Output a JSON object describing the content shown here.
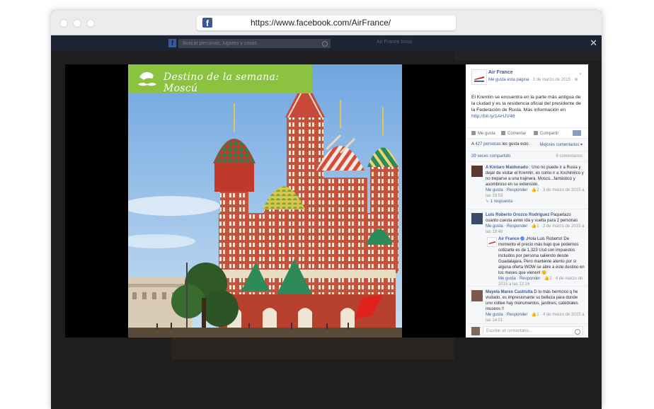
{
  "browser": {
    "url": "https://www.facebook.com/AirFrance/",
    "favicon": "facebook-f-icon"
  },
  "fb_header": {
    "search_placeholder": "Buscar personas, lugares y cosas",
    "right_text": "Air France  Inicio"
  },
  "photo": {
    "banner_text": "Destino de la semana: Moscú",
    "banner_color": "#8bc23f"
  },
  "post": {
    "page_name": "Air France",
    "like_page": "Me gusta esta página",
    "date": "3 de marzo de 2015",
    "text": "El Kremlin se encuentra en la parte más antigua de la ciudad y es la residencia oficial del presidente de la Federación de Rusia. Más información en",
    "link": "http://bit.ly/1AHJV46",
    "actions": {
      "like": "Me gusta",
      "comment": "Comentar",
      "share": "Compartir"
    },
    "likes_prefix": "A",
    "likes_people": "427 personas",
    "likes_suffix": "les gusta esto.",
    "sort": "Mejores comentarios",
    "shares": "39 veces compartido",
    "comment_count": "9 comentarios"
  },
  "comments": [
    {
      "author": "A Kintaro Maldonado",
      "text": ": Uno no puede ir a Rusia y dejar de visitar el Kremlin, es como ir a Xochimilco y no treparse a una trajinera. Moscú...fantástico y asombroso en su extensión.",
      "like": "Me gusta",
      "reply": "Responder",
      "count": "2",
      "date": "3 de marzo de 2015 a las 19:53",
      "replies_link": "1 respuesta"
    },
    {
      "author": "Luis Roberto Orozco Rodríguez",
      "text": "Paquetazo cuanto cuesta avion ida y vuelta para 2 personas",
      "like": "Me gusta",
      "reply": "Responder",
      "count": "1",
      "date": "3 de marzo de 2015 a las 19:48"
    },
    {
      "author": "Air France",
      "text": "¡Hola Luis Roberto! De momento el precio más bajo que podemos cotizarte es de 1,323 Usd con impuestos incluidos por persona saliendo desde Guadalajara. Pero mantente atento por si alguna oferta WOW se abre a este destino en los meses que vienen! 🙂",
      "like": "Me gusta",
      "reply": "Responder",
      "count": "2",
      "date": "4 de marzo de 2015 a las 12:16"
    },
    {
      "author": "Mayela Mares Castruita",
      "text": "D lo más hermoso q he visitado, es impresionante su belleza para donde uno voltee hay monumentos, jardines, catedrales museos !!",
      "like": "Me gusta",
      "reply": "Responder",
      "count": "1",
      "date": "4 de marzo de 2015 a las 14:01"
    }
  ],
  "comment_input": {
    "placeholder": "Escribe un comentario..."
  }
}
